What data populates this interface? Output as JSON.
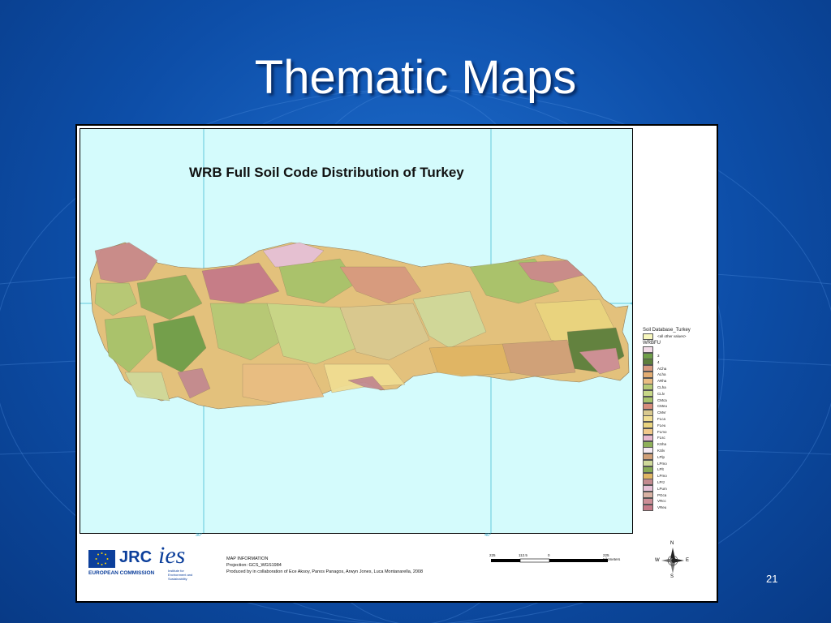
{
  "slide": {
    "title": "Thematic Maps",
    "page_number": "21"
  },
  "map": {
    "title": "WRB Full Soil Code Distribution of Turkey",
    "graticule_labels": [
      "30°",
      "40°"
    ],
    "side_marker": "§",
    "colors": {
      "sea": "#d4fbfc",
      "graticule": "#62c9dc"
    },
    "legend": {
      "title": "Soil Database_Turkey",
      "other_label": "<all other values>",
      "field": "WRBFU",
      "items": [
        {
          "label": "",
          "color": "#f2dce8"
        },
        {
          "label": "3",
          "color": "#6f9e49"
        },
        {
          "label": "4",
          "color": "#5d7f3c"
        },
        {
          "label": "ACha",
          "color": "#d79a7f"
        },
        {
          "label": "ALha",
          "color": "#e3ad72"
        },
        {
          "label": "ARha",
          "color": "#e9bd82"
        },
        {
          "label": "CLha",
          "color": "#b5c975"
        },
        {
          "label": "CLlv",
          "color": "#c7d787"
        },
        {
          "label": "CMca",
          "color": "#a8c36b"
        },
        {
          "label": "CMeu",
          "color": "#d78d7c"
        },
        {
          "label": "CMvr",
          "color": "#d9c98f"
        },
        {
          "label": "FLca",
          "color": "#f0dd92"
        },
        {
          "label": "FLeu",
          "color": "#ead47f"
        },
        {
          "label": "FLmo",
          "color": "#f1c98a"
        },
        {
          "label": "FLsc",
          "color": "#e7b8cd"
        },
        {
          "label": "KSha",
          "color": "#8eb05a"
        },
        {
          "label": "KSlv",
          "color": "#f5eaf2"
        },
        {
          "label": "LPlp",
          "color": "#d0a078"
        },
        {
          "label": "LPmo",
          "color": "#cfd99a"
        },
        {
          "label": "LPlt",
          "color": "#88ab55"
        },
        {
          "label": "LPmo",
          "color": "#e0b563"
        },
        {
          "label": "LPrz",
          "color": "#c38a8f"
        },
        {
          "label": "LPum",
          "color": "#e6c0d6"
        },
        {
          "label": "PGca",
          "color": "#d9b2a3"
        },
        {
          "label": "VRcc",
          "color": "#cc8e96"
        },
        {
          "label": "VReu",
          "color": "#c57a88"
        }
      ]
    },
    "info": {
      "heading": "MAP INFORMATION",
      "projection": "Projection: GCS_WGS1984",
      "credits": "Produced by in collaboration of Ece Aksoy, Panos Panagos, Arwyn Jones, Luca Montanarella, 2008"
    },
    "scale": {
      "labels": [
        "225",
        "112.5",
        "0",
        "225 Kilometers"
      ]
    },
    "compass": {
      "n": "N",
      "s": "S",
      "e": "E",
      "w": "W"
    },
    "logos": {
      "jrc": "JRC",
      "ec": "EUROPEAN COMMISSION",
      "ies": "ies",
      "ies_sub": "Institute for Environment and Sustainability"
    }
  }
}
